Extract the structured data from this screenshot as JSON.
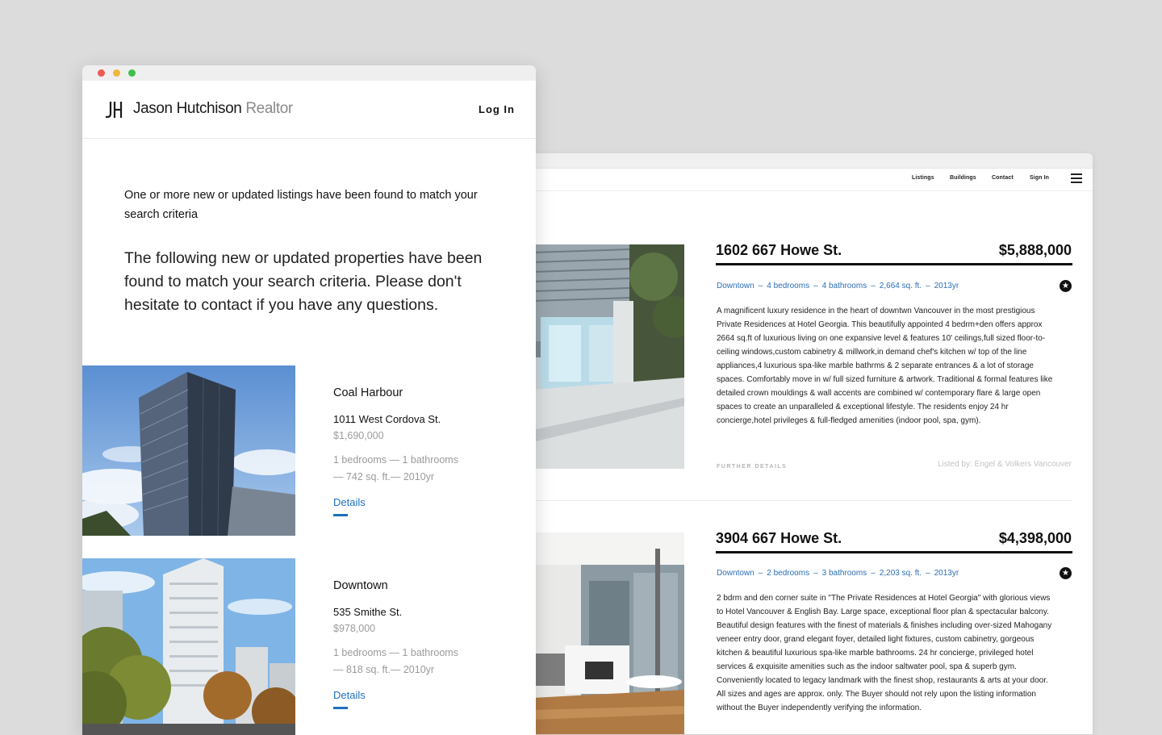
{
  "site": {
    "nav": [
      "Listings",
      "Buildings",
      "Contact",
      "Sign In"
    ],
    "listings": [
      {
        "address": "1602 667 Howe St.",
        "price": "$5,888,000",
        "meta": [
          "Downtown",
          "4 bedrooms",
          "4 bathrooms",
          "2,664 sq. ft.",
          "2013yr"
        ],
        "description": "A magnificent luxury residence in the heart of downtwn Vancouver in the most prestigious Private Residences at Hotel Georgia. This beautifully appointed 4 bedrm+den offers approx 2664 sq.ft of luxurious living on one expansive level & features 10' ceilings,full sized floor-to-ceiling windows,custom cabinetry & millwork,in demand chef's kitchen w/ top of the line appliances,4 luxurious spa-like marble bathrms & 2 separate entrances & a lot of storage spaces. Comfortably move in w/ full sized furniture & artwork. Traditional & formal features like detailed crown mouldings & wall accents are combined w/ contemporary flare & large open spaces to create an unparalleled & exceptional lifestyle. The residents enjoy 24 hr concierge,hotel privileges & full-fledged amenities (indoor pool, spa, gym).",
        "further_details": "FURTHER DETAILS",
        "listed_by": "Listed by: Engel & Volkers Vancouver"
      },
      {
        "address": "3904 667 Howe St.",
        "price": "$4,398,000",
        "meta": [
          "Downtown",
          "2 bedrooms",
          "3 bathrooms",
          "2,203 sq. ft.",
          "2013yr"
        ],
        "description": "2 bdrm and den corner suite in \"The Private Residences at Hotel Georgia\" with glorious views to Hotel Vancouver & English Bay. Large space, exceptional floor plan & spectacular balcony. Beautiful design features with the finest of materials & finishes including over-sized Mahogany veneer entry door, grand elegant foyer, detailed light fixtures, custom cabinetry, gorgeous kitchen & beautiful luxurious spa-like marble bathrooms. 24 hr concierge, privileged hotel services & exquisite amenities such as the indoor saltwater pool, spa & superb gym. Conveniently located to legacy landmark with the finest shop, restaurants & arts at your door. All sizes and ages are approx. only. The Buyer should not rely upon the listing information without the Buyer independently verifying the information."
      }
    ]
  },
  "email": {
    "brand_name": "Jason Hutchison",
    "brand_role": "Realtor",
    "login_label": "Log In",
    "intro_small": "One or more new or updated listings have been found to match your search criteria",
    "intro_large": "The following new or updated properties have been found to match your search criteria. Please don't hesitate to contact if you have any questions.",
    "properties": [
      {
        "area": "Coal Harbour",
        "address": "1011 West Cordova St.",
        "price": "$1,690,000",
        "stats_line1": "1 bedrooms — 1 bathrooms",
        "stats_line2": "— 742 sq. ft.— 2010yr",
        "details_label": "Details"
      },
      {
        "area": "Downtown",
        "address": "535 Smithe St.",
        "price": "$978,000",
        "stats_line1": "1 bedrooms — 1 bathrooms",
        "stats_line2": "— 818 sq. ft.— 2010yr",
        "details_label": "Details"
      }
    ]
  },
  "colors": {
    "accent_blue": "#1f6fbf",
    "background": "#dcdcdc",
    "dot_red": "#ef5a52",
    "dot_yellow": "#f3b63a",
    "dot_green": "#3fc048"
  },
  "icons": [
    "favorite-star-icon",
    "hamburger-menu-icon",
    "brand-logo-icon"
  ]
}
